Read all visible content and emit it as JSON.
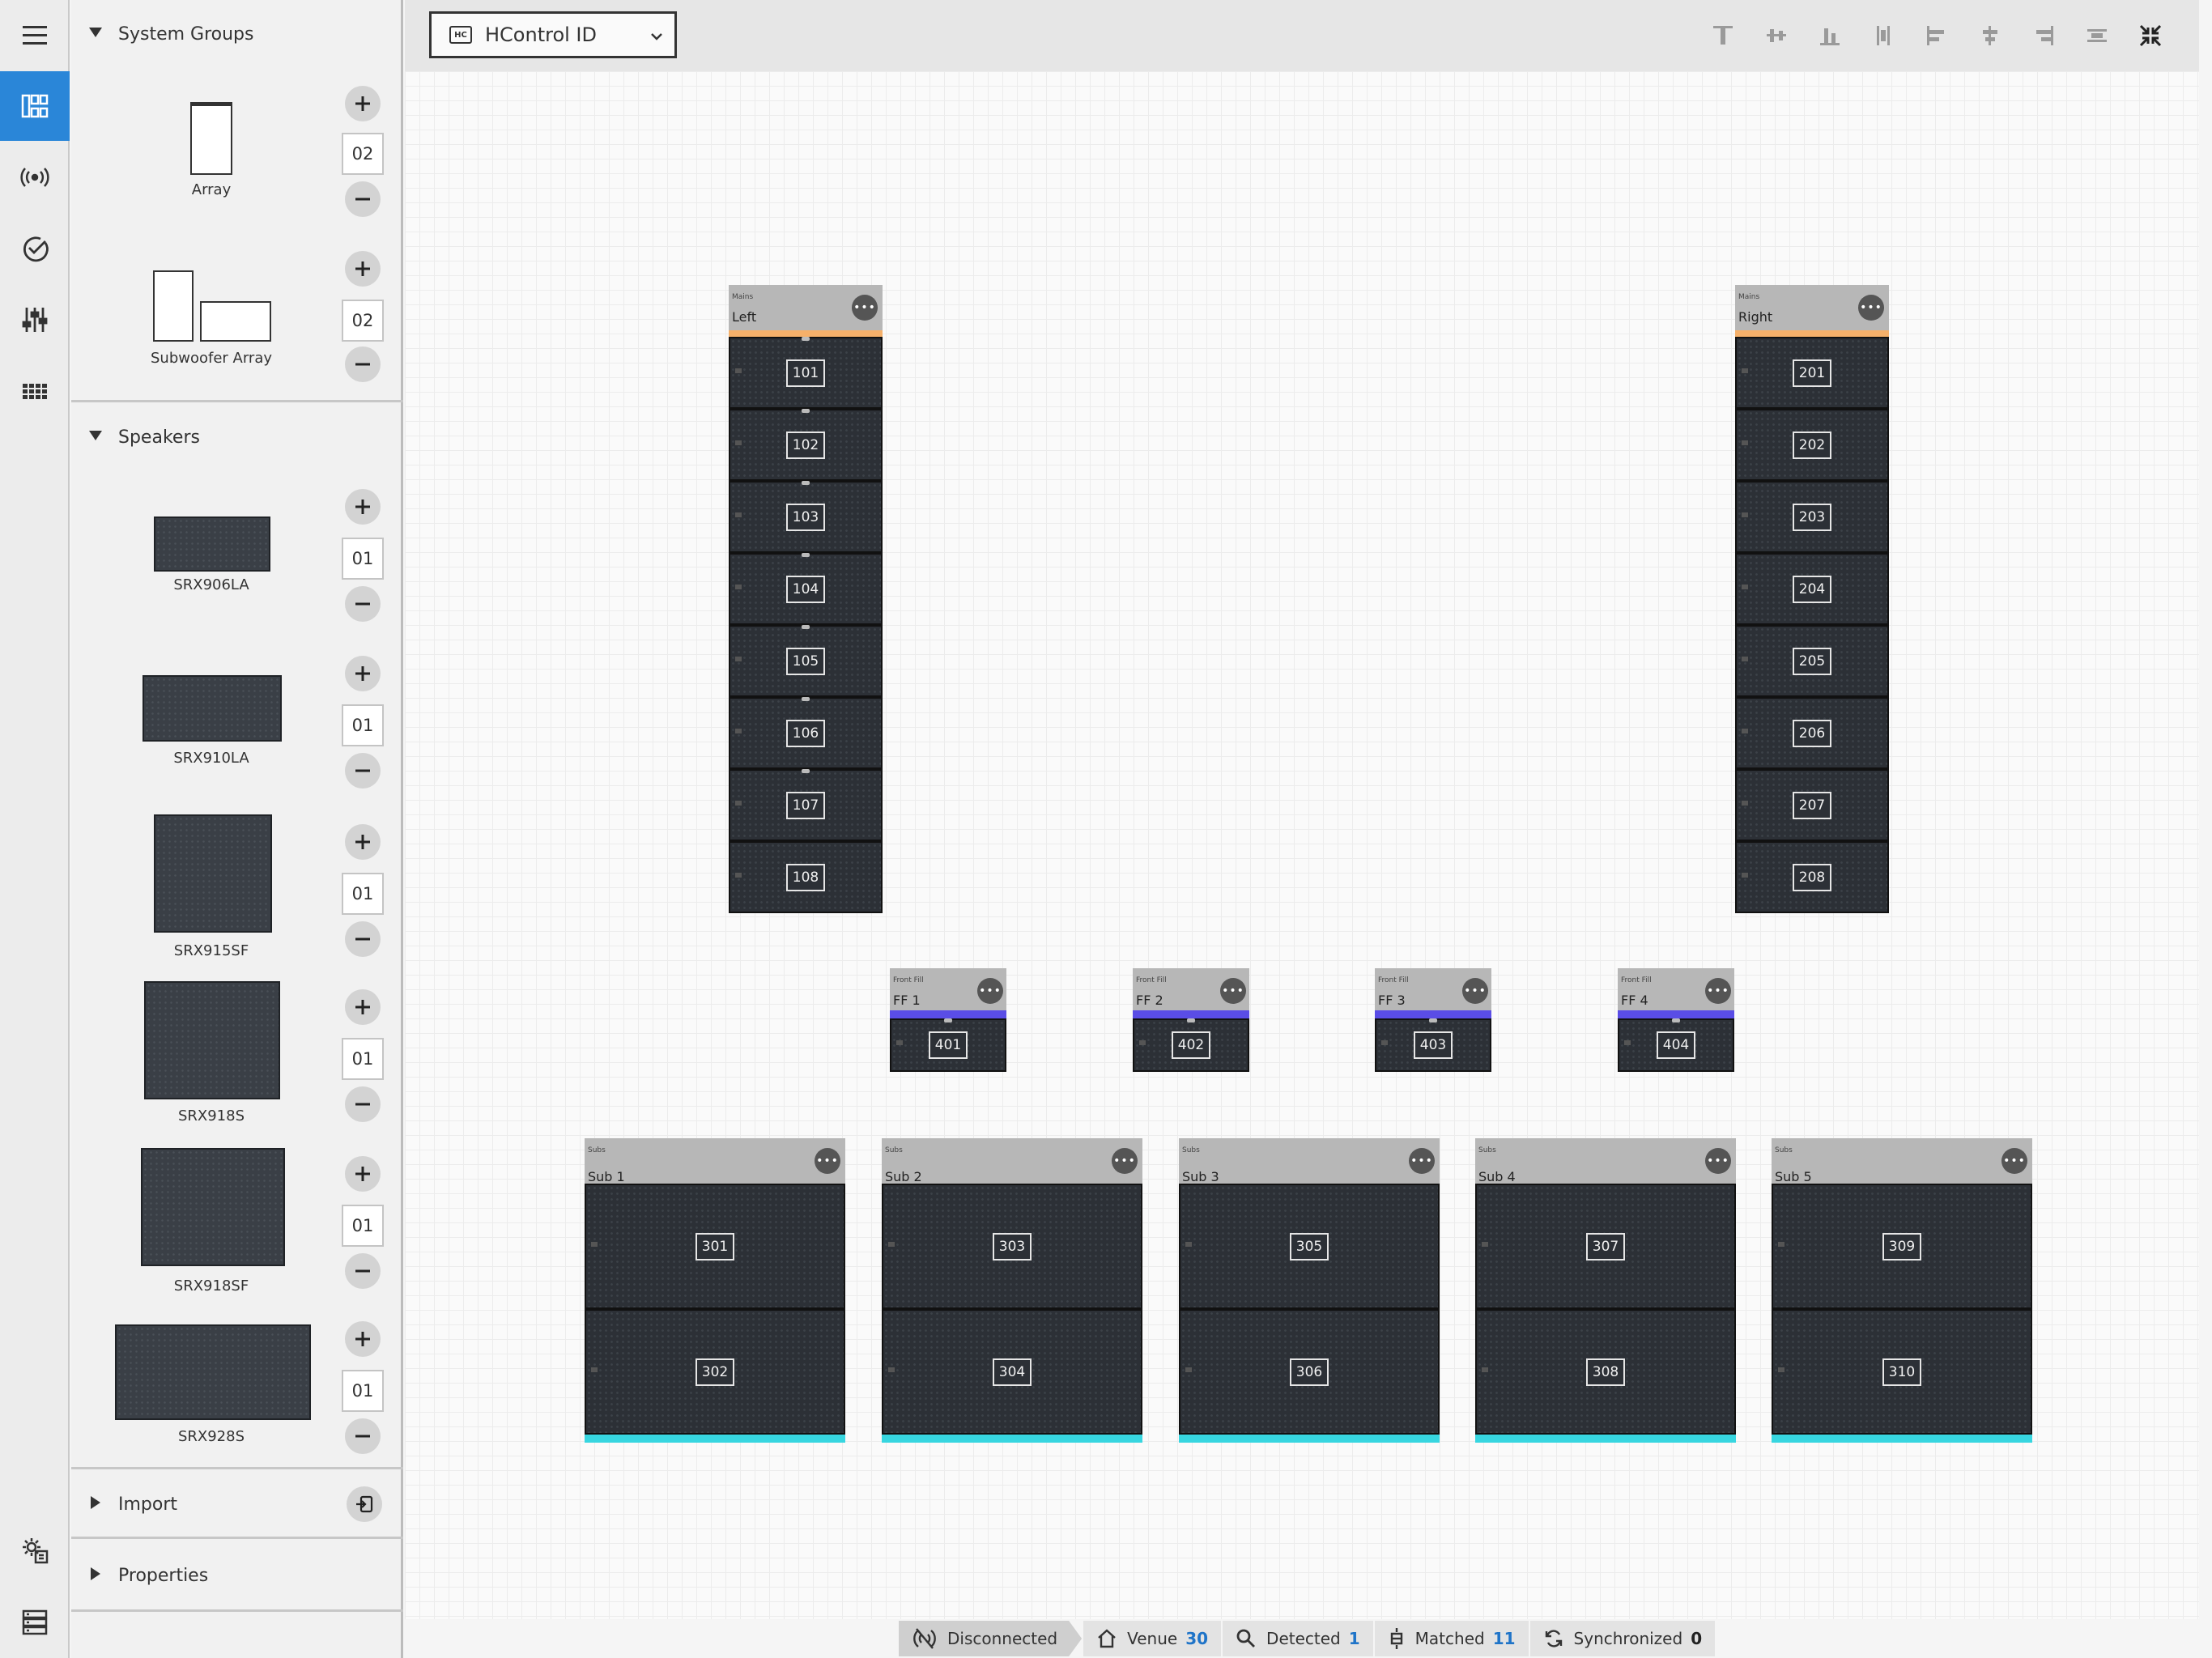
{
  "rail": {
    "items": [
      {
        "name": "menu-icon"
      },
      {
        "name": "layout-icon",
        "active": true
      },
      {
        "name": "wireless-icon"
      },
      {
        "name": "check-circle-icon"
      },
      {
        "name": "sliders-icon"
      },
      {
        "name": "grid-dots-icon"
      },
      {
        "name": "settings-device-icon"
      },
      {
        "name": "server-list-icon"
      }
    ]
  },
  "panel": {
    "system_groups": {
      "title": "System Groups",
      "items": [
        {
          "label": "Array",
          "count": "02"
        },
        {
          "label": "Subwoofer Array",
          "count": "02"
        }
      ]
    },
    "speakers": {
      "title": "Speakers",
      "items": [
        {
          "label": "SRX906LA",
          "count": "01"
        },
        {
          "label": "SRX910LA",
          "count": "01"
        },
        {
          "label": "SRX915SF",
          "count": "01"
        },
        {
          "label": "SRX918S",
          "count": "01"
        },
        {
          "label": "SRX918SF",
          "count": "01"
        },
        {
          "label": "SRX928S",
          "count": "01"
        }
      ]
    },
    "import": {
      "title": "Import"
    },
    "properties": {
      "title": "Properties"
    }
  },
  "toolbar": {
    "select_badge": "HC",
    "select_value": "HControl ID",
    "icons": [
      "align-top-icon",
      "align-middle-icon",
      "align-bottom-icon",
      "distribute-vertical-icon",
      "align-left-icon",
      "align-center-icon",
      "align-right-icon",
      "distribute-horizontal-icon",
      "collapse-icon"
    ]
  },
  "canvas": {
    "mains": [
      {
        "category": "Mains",
        "name": "Left",
        "bar_color": "#f5b06a",
        "ids": [
          "101",
          "102",
          "103",
          "104",
          "105",
          "106",
          "107",
          "108"
        ]
      },
      {
        "category": "Mains",
        "name": "Right",
        "bar_color": "#f5b06a",
        "ids": [
          "201",
          "202",
          "203",
          "204",
          "205",
          "206",
          "207",
          "208"
        ]
      }
    ],
    "front_fills": [
      {
        "category": "Front Fill",
        "name": "FF 1",
        "bar_color": "#5a4de6",
        "id": "401"
      },
      {
        "category": "Front Fill",
        "name": "FF 2",
        "bar_color": "#5a4de6",
        "id": "402"
      },
      {
        "category": "Front Fill",
        "name": "FF 3",
        "bar_color": "#5a4de6",
        "id": "403"
      },
      {
        "category": "Front Fill",
        "name": "FF 4",
        "bar_color": "#5a4de6",
        "id": "404"
      }
    ],
    "subs": [
      {
        "category": "Subs",
        "name": "Sub 1",
        "bar_color": "#37d6e0",
        "ids": [
          "301",
          "302"
        ]
      },
      {
        "category": "Subs",
        "name": "Sub 2",
        "bar_color": "#37d6e0",
        "ids": [
          "303",
          "304"
        ]
      },
      {
        "category": "Subs",
        "name": "Sub 3",
        "bar_color": "#37d6e0",
        "ids": [
          "305",
          "306"
        ]
      },
      {
        "category": "Subs",
        "name": "Sub 4",
        "bar_color": "#37d6e0",
        "ids": [
          "307",
          "308"
        ]
      },
      {
        "category": "Subs",
        "name": "Sub 5",
        "bar_color": "#37d6e0",
        "ids": [
          "309",
          "310"
        ]
      }
    ]
  },
  "status": {
    "connection": "Disconnected",
    "venue_label": "Venue",
    "venue_count": "30",
    "detected_label": "Detected",
    "detected_count": "1",
    "matched_label": "Matched",
    "matched_count": "11",
    "synchronized_label": "Synchronized",
    "synchronized_count": "0"
  }
}
